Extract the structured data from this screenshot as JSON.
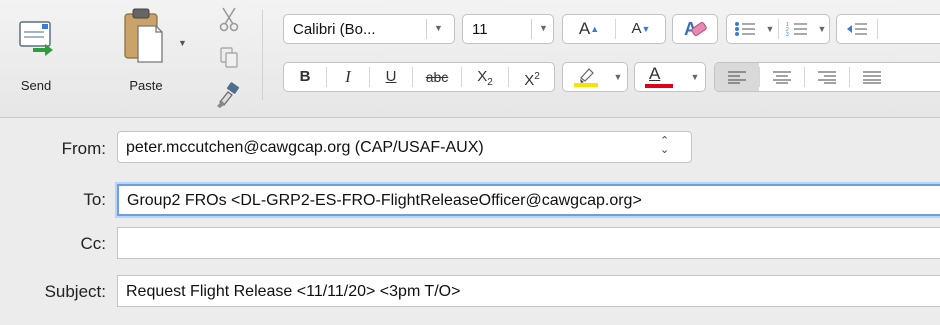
{
  "toolbar": {
    "send_label": "Send",
    "paste_label": "Paste",
    "font_name": "Calibri (Bo...",
    "font_size": "11",
    "buttons": {
      "grow_font": "A",
      "shrink_font": "A",
      "bold": "B",
      "italic": "I",
      "underline": "U",
      "strikethrough": "abc",
      "subscript": "X",
      "subscript_mark": "2",
      "superscript": "X",
      "superscript_mark": "2",
      "font_color": "A"
    },
    "colors": {
      "highlight": "#f5e400",
      "font_color": "#e0001b",
      "send_arrow": "#2e9e3c"
    }
  },
  "header": {
    "from_label": "From:",
    "from_value": "peter.mccutchen@cawgcap.org (CAP/USAF-AUX)",
    "to_label": "To:",
    "to_value": "Group2 FROs <DL-GRP2-ES-FRO-FlightReleaseOfficer@cawgcap.org>",
    "cc_label": "Cc:",
    "cc_value": "",
    "subject_label": "Subject:",
    "subject_value": "Request Flight Release <11/11/20> <3pm T/O>"
  }
}
